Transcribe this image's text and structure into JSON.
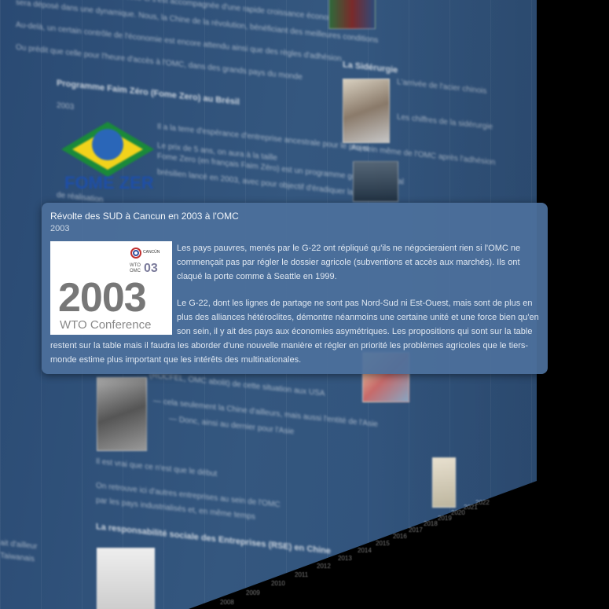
{
  "popup": {
    "title": "Révolte des SUD à Cancun en 2003 à l'OMC",
    "year": "2003",
    "image": {
      "year_text": "2003",
      "caption": "WTO Conference",
      "logo_text": "CANCÚN 03"
    },
    "paragraphs": [
      "Les pays pauvres, menés par le G-22 ont répliqué qu'ils ne négocieraient rien si l'OMC ne commençait pas par régler le dossier agricole (subventions et accès aux marchés). Ils ont claqué la porte comme à Seattle en 1999.",
      "Le G-22, dont les lignes de partage ne sont pas Nord-Sud ni Est-Ouest, mais sont de plus en plus des alliances hétéroclites, démontre néanmoins une certaine unité et une force bien qu'en son sein, il y ait des pays aux économies asymétriques. Les propositions qui sont sur la table restent sur la table mais il faudra les aborder d'une nouvelle manière et régler en priorité les problèmes agricoles que le tiers-monde estime plus important que les intérêts des multinationales."
    ]
  },
  "background": {
    "headings": [
      "Programme Faim Zéro (Fome Zero) au Brésil",
      "La Sidérurgie",
      "La responsabilité sociale des Entreprises (RSE) en Chine"
    ],
    "logo_text": "FOME ZERO",
    "timeline_years": [
      "2008",
      "2009",
      "2010",
      "2011",
      "2012",
      "2013",
      "2014",
      "2015",
      "2016",
      "2017",
      "2018",
      "2019",
      "2020",
      "2021",
      "2022"
    ]
  },
  "colors": {
    "wall": "#34577f",
    "popup": "#4c709c",
    "brazil_green": "#1a8a3a",
    "brazil_yellow": "#f2d21b"
  }
}
